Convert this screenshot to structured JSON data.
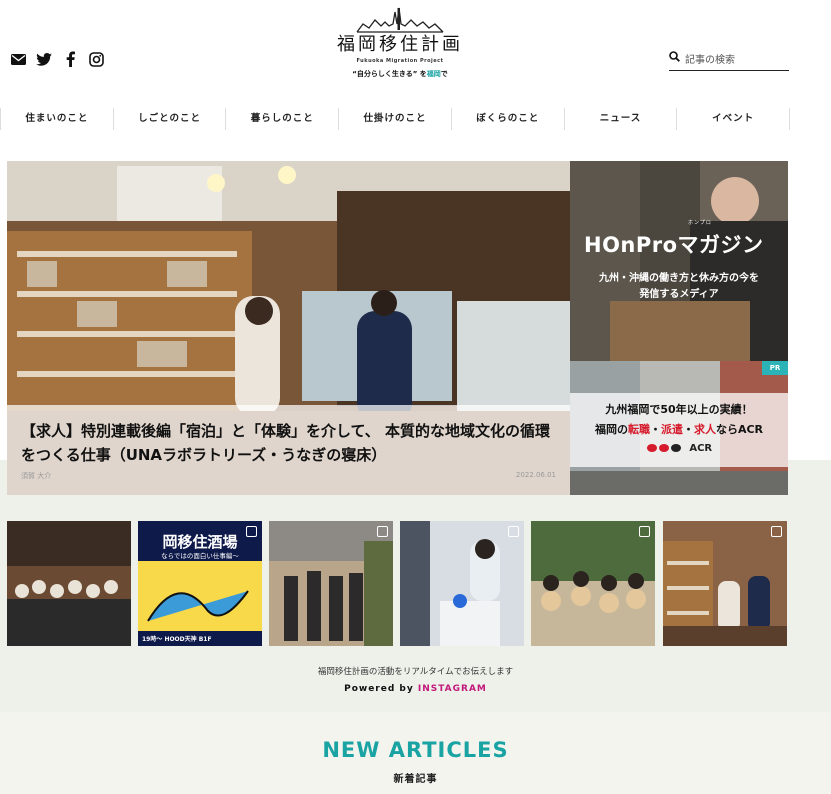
{
  "header": {
    "social_icons": [
      "mail-icon",
      "twitter-icon",
      "facebook-icon",
      "instagram-icon"
    ],
    "logo": {
      "title": "福岡移住計画",
      "subtitle_en": "Fukuoka Migration Project",
      "tagline_pre": "“自分らしく生きる” を",
      "tagline_hl": "福岡",
      "tagline_post": "で"
    },
    "search": {
      "icon": "search-icon",
      "placeholder": "記事の検索"
    }
  },
  "nav": {
    "items": [
      "住まいのこと",
      "しごとのこと",
      "暮らしのこと",
      "仕掛けのこと",
      "ぼくらのこと",
      "ニュース",
      "イベント"
    ]
  },
  "hero": {
    "title": "【求人】特別連載後編「宿泊」と「体験」を介して、 本質的な地域文化の循環をつくる仕事（UNAラボラトリーズ・うなぎの寝床）",
    "author": "須賀 大介",
    "date": "2022.06.01"
  },
  "banner1": {
    "logo": "HOnProマガジン",
    "ruby": "ホンプロ",
    "text_line1": "九州・沖縄の働き方と休み方の今を",
    "text_line2": "発信するメディア"
  },
  "banner2": {
    "badge": "PR",
    "line1": "九州福岡で50年以上の実績！",
    "line2_pre": "福岡の",
    "line2_red1": "転職",
    "line2_sep1": "・",
    "line2_red2": "派遣",
    "line2_sep2": "・",
    "line2_red3": "求人",
    "line2_post": "ならACR",
    "brand": "ACR"
  },
  "instagram": {
    "tile2_text1": "岡移住酒場",
    "tile2_text2": "ならではの面白い仕事編〜",
    "tile2_text3": "19時〜 HOOD天神 B1F",
    "caption": "福岡移住計画の活動をリアルタイムでお伝えします",
    "powered_pre": "Powered by ",
    "powered_brand": "INSTAGRAM"
  },
  "section": {
    "title": "NEW ARTICLES",
    "subtitle": "新着記事"
  },
  "colors": {
    "accent": "#1aa3a3",
    "instagram": "#c2187a",
    "acr_red": "#d61c2c",
    "pr_badge": "#2bb3b8"
  }
}
